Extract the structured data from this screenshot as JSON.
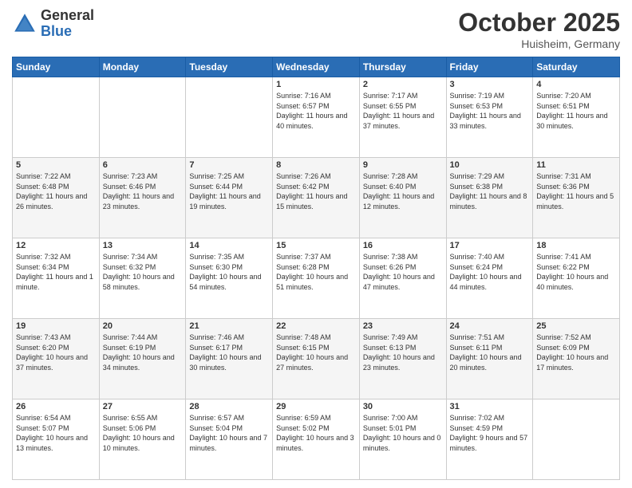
{
  "header": {
    "logo_general": "General",
    "logo_blue": "Blue",
    "month_title": "October 2025",
    "location": "Huisheim, Germany"
  },
  "weekdays": [
    "Sunday",
    "Monday",
    "Tuesday",
    "Wednesday",
    "Thursday",
    "Friday",
    "Saturday"
  ],
  "weeks": [
    [
      {
        "day": "",
        "sunrise": "",
        "sunset": "",
        "daylight": ""
      },
      {
        "day": "",
        "sunrise": "",
        "sunset": "",
        "daylight": ""
      },
      {
        "day": "",
        "sunrise": "",
        "sunset": "",
        "daylight": ""
      },
      {
        "day": "1",
        "sunrise": "Sunrise: 7:16 AM",
        "sunset": "Sunset: 6:57 PM",
        "daylight": "Daylight: 11 hours and 40 minutes."
      },
      {
        "day": "2",
        "sunrise": "Sunrise: 7:17 AM",
        "sunset": "Sunset: 6:55 PM",
        "daylight": "Daylight: 11 hours and 37 minutes."
      },
      {
        "day": "3",
        "sunrise": "Sunrise: 7:19 AM",
        "sunset": "Sunset: 6:53 PM",
        "daylight": "Daylight: 11 hours and 33 minutes."
      },
      {
        "day": "4",
        "sunrise": "Sunrise: 7:20 AM",
        "sunset": "Sunset: 6:51 PM",
        "daylight": "Daylight: 11 hours and 30 minutes."
      }
    ],
    [
      {
        "day": "5",
        "sunrise": "Sunrise: 7:22 AM",
        "sunset": "Sunset: 6:48 PM",
        "daylight": "Daylight: 11 hours and 26 minutes."
      },
      {
        "day": "6",
        "sunrise": "Sunrise: 7:23 AM",
        "sunset": "Sunset: 6:46 PM",
        "daylight": "Daylight: 11 hours and 23 minutes."
      },
      {
        "day": "7",
        "sunrise": "Sunrise: 7:25 AM",
        "sunset": "Sunset: 6:44 PM",
        "daylight": "Daylight: 11 hours and 19 minutes."
      },
      {
        "day": "8",
        "sunrise": "Sunrise: 7:26 AM",
        "sunset": "Sunset: 6:42 PM",
        "daylight": "Daylight: 11 hours and 15 minutes."
      },
      {
        "day": "9",
        "sunrise": "Sunrise: 7:28 AM",
        "sunset": "Sunset: 6:40 PM",
        "daylight": "Daylight: 11 hours and 12 minutes."
      },
      {
        "day": "10",
        "sunrise": "Sunrise: 7:29 AM",
        "sunset": "Sunset: 6:38 PM",
        "daylight": "Daylight: 11 hours and 8 minutes."
      },
      {
        "day": "11",
        "sunrise": "Sunrise: 7:31 AM",
        "sunset": "Sunset: 6:36 PM",
        "daylight": "Daylight: 11 hours and 5 minutes."
      }
    ],
    [
      {
        "day": "12",
        "sunrise": "Sunrise: 7:32 AM",
        "sunset": "Sunset: 6:34 PM",
        "daylight": "Daylight: 11 hours and 1 minute."
      },
      {
        "day": "13",
        "sunrise": "Sunrise: 7:34 AM",
        "sunset": "Sunset: 6:32 PM",
        "daylight": "Daylight: 10 hours and 58 minutes."
      },
      {
        "day": "14",
        "sunrise": "Sunrise: 7:35 AM",
        "sunset": "Sunset: 6:30 PM",
        "daylight": "Daylight: 10 hours and 54 minutes."
      },
      {
        "day": "15",
        "sunrise": "Sunrise: 7:37 AM",
        "sunset": "Sunset: 6:28 PM",
        "daylight": "Daylight: 10 hours and 51 minutes."
      },
      {
        "day": "16",
        "sunrise": "Sunrise: 7:38 AM",
        "sunset": "Sunset: 6:26 PM",
        "daylight": "Daylight: 10 hours and 47 minutes."
      },
      {
        "day": "17",
        "sunrise": "Sunrise: 7:40 AM",
        "sunset": "Sunset: 6:24 PM",
        "daylight": "Daylight: 10 hours and 44 minutes."
      },
      {
        "day": "18",
        "sunrise": "Sunrise: 7:41 AM",
        "sunset": "Sunset: 6:22 PM",
        "daylight": "Daylight: 10 hours and 40 minutes."
      }
    ],
    [
      {
        "day": "19",
        "sunrise": "Sunrise: 7:43 AM",
        "sunset": "Sunset: 6:20 PM",
        "daylight": "Daylight: 10 hours and 37 minutes."
      },
      {
        "day": "20",
        "sunrise": "Sunrise: 7:44 AM",
        "sunset": "Sunset: 6:19 PM",
        "daylight": "Daylight: 10 hours and 34 minutes."
      },
      {
        "day": "21",
        "sunrise": "Sunrise: 7:46 AM",
        "sunset": "Sunset: 6:17 PM",
        "daylight": "Daylight: 10 hours and 30 minutes."
      },
      {
        "day": "22",
        "sunrise": "Sunrise: 7:48 AM",
        "sunset": "Sunset: 6:15 PM",
        "daylight": "Daylight: 10 hours and 27 minutes."
      },
      {
        "day": "23",
        "sunrise": "Sunrise: 7:49 AM",
        "sunset": "Sunset: 6:13 PM",
        "daylight": "Daylight: 10 hours and 23 minutes."
      },
      {
        "day": "24",
        "sunrise": "Sunrise: 7:51 AM",
        "sunset": "Sunset: 6:11 PM",
        "daylight": "Daylight: 10 hours and 20 minutes."
      },
      {
        "day": "25",
        "sunrise": "Sunrise: 7:52 AM",
        "sunset": "Sunset: 6:09 PM",
        "daylight": "Daylight: 10 hours and 17 minutes."
      }
    ],
    [
      {
        "day": "26",
        "sunrise": "Sunrise: 6:54 AM",
        "sunset": "Sunset: 5:07 PM",
        "daylight": "Daylight: 10 hours and 13 minutes."
      },
      {
        "day": "27",
        "sunrise": "Sunrise: 6:55 AM",
        "sunset": "Sunset: 5:06 PM",
        "daylight": "Daylight: 10 hours and 10 minutes."
      },
      {
        "day": "28",
        "sunrise": "Sunrise: 6:57 AM",
        "sunset": "Sunset: 5:04 PM",
        "daylight": "Daylight: 10 hours and 7 minutes."
      },
      {
        "day": "29",
        "sunrise": "Sunrise: 6:59 AM",
        "sunset": "Sunset: 5:02 PM",
        "daylight": "Daylight: 10 hours and 3 minutes."
      },
      {
        "day": "30",
        "sunrise": "Sunrise: 7:00 AM",
        "sunset": "Sunset: 5:01 PM",
        "daylight": "Daylight: 10 hours and 0 minutes."
      },
      {
        "day": "31",
        "sunrise": "Sunrise: 7:02 AM",
        "sunset": "Sunset: 4:59 PM",
        "daylight": "Daylight: 9 hours and 57 minutes."
      },
      {
        "day": "",
        "sunrise": "",
        "sunset": "",
        "daylight": ""
      }
    ]
  ]
}
